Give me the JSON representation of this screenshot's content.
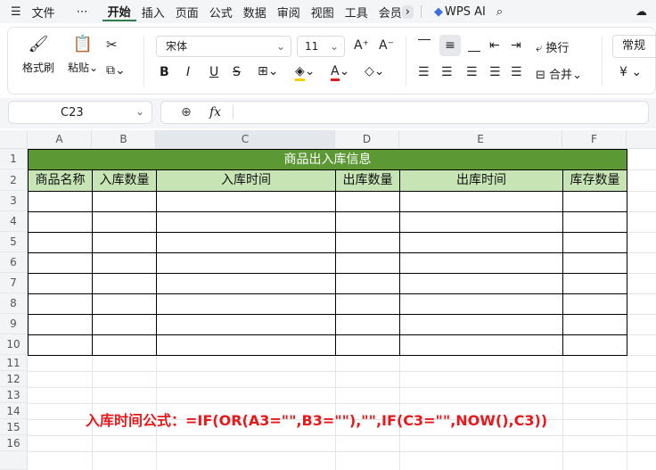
{
  "menubar": {
    "menu_icon": "☰",
    "file": "文件",
    "more": "⋯",
    "tabs": [
      "开始",
      "插入",
      "页面",
      "公式",
      "数据",
      "审阅",
      "视图",
      "工具",
      "会员"
    ],
    "wps_ai": "WPS AI"
  },
  "ribbon": {
    "format_painter": "格式刷",
    "paste": "粘贴",
    "font_name": "宋体",
    "font_size": "11",
    "wrap": "换行",
    "merge": "合并",
    "number_format": "常规",
    "currency": "¥"
  },
  "formulabar": {
    "cell_ref": "C23",
    "fx": "fx",
    "formula": ""
  },
  "sheet": {
    "columns": [
      "A",
      "B",
      "C",
      "D",
      "E",
      "F"
    ],
    "rows": [
      "1",
      "2",
      "3",
      "4",
      "5",
      "6",
      "7",
      "8",
      "9",
      "10",
      "11",
      "12",
      "13",
      "14",
      "15",
      "16"
    ],
    "table_title": "商品出入库信息",
    "headers": [
      "商品名称",
      "入库数量",
      "入库时间",
      "出库数量",
      "出库时间",
      "库存数量"
    ],
    "note": "入库时间公式：=IF(OR(A3=\"\",B3=\"\"),\"\",IF(C3=\"\",NOW(),C3))"
  },
  "colors": {
    "title_green": "#5c9935",
    "header_green": "#c6e4b4",
    "note_red": "#e8191c",
    "active_tab_underline": "#2f7d4a"
  }
}
